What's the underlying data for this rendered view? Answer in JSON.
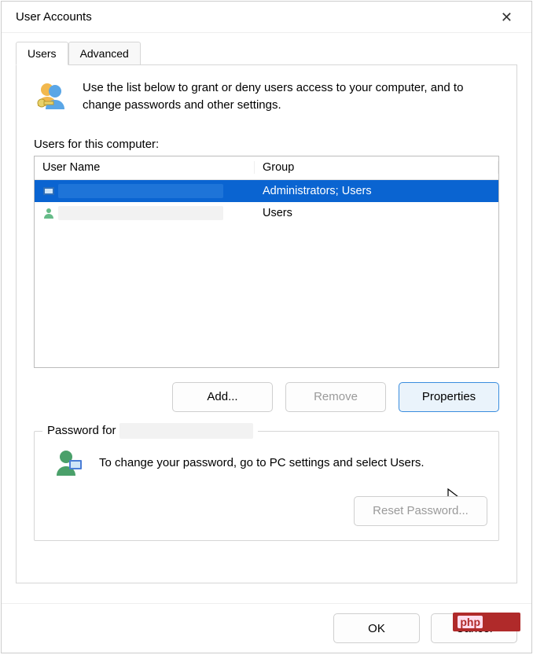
{
  "window": {
    "title": "User Accounts",
    "close_label": "✕"
  },
  "tabs": [
    {
      "label": "Users",
      "active": true
    },
    {
      "label": "Advanced",
      "active": false
    }
  ],
  "intro": "Use the list below to grant or deny users access to your computer, and to change passwords and other settings.",
  "list_label": "Users for this computer:",
  "columns": {
    "name": "User Name",
    "group": "Group"
  },
  "rows": [
    {
      "name": "",
      "group": "Administrators; Users",
      "selected": true
    },
    {
      "name": "",
      "group": "Users",
      "selected": false
    }
  ],
  "buttons": {
    "add": "Add...",
    "remove": "Remove",
    "properties": "Properties"
  },
  "password_section": {
    "legend_prefix": "Password for",
    "legend_user": "",
    "text": "To change your password, go to PC settings and select Users.",
    "reset": "Reset Password..."
  },
  "footer": {
    "ok": "OK",
    "cancel": "Cancel"
  },
  "badge": "php"
}
